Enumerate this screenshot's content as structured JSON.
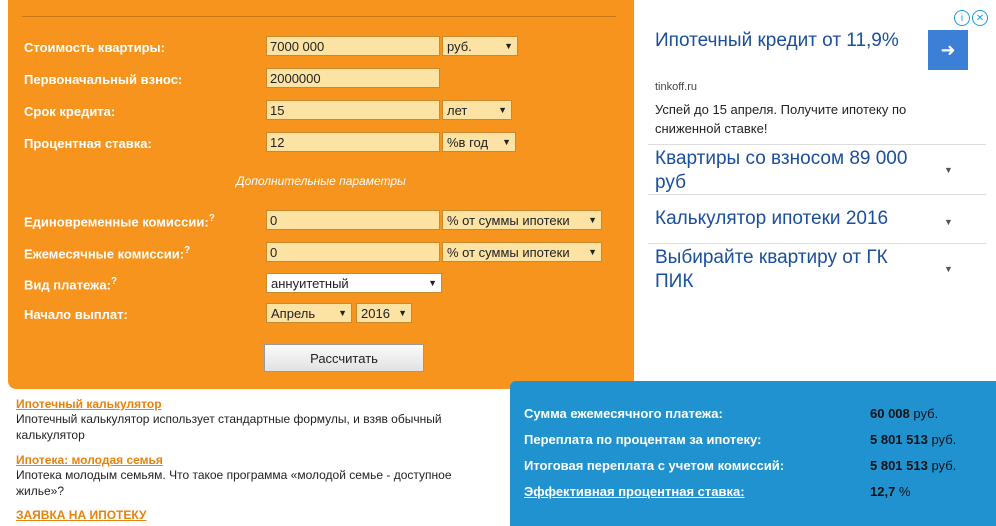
{
  "calculator": {
    "price_label": "Стоимость квартиры:",
    "price_value": "7000 000",
    "price_currency": "руб.",
    "downpayment_label": "Первоначальный взнос:",
    "downpayment_value": "2000000",
    "term_label": "Срок кредита:",
    "term_value": "15",
    "term_unit": "лет",
    "rate_label": "Процентная ставка:",
    "rate_value": "12",
    "rate_unit": "%в год",
    "extra_params": "Дополнительные параметры",
    "onetime_label": "Единовременные комиссии:",
    "onetime_value": "0",
    "onetime_unit": "% от суммы ипотеки",
    "monthly_label": "Ежемесячные комиссии:",
    "monthly_value": "0",
    "monthly_unit": "% от суммы ипотеки",
    "paytype_label": "Вид платежа:",
    "paytype_value": "аннуитетный",
    "start_label": "Начало выплат:",
    "start_month": "Апрель",
    "start_year": "2016",
    "help_mark": "?",
    "calculate_button": "Рассчитать"
  },
  "ad": {
    "headline": "Ипотечный кредит от 11,9%",
    "domain": "tinkoff.ru",
    "description": "Успей до 15 апреля. Получите ипотеку по сниженной ставке!",
    "items": [
      {
        "title": "Квартиры со взносом 89 000 руб"
      },
      {
        "title": "Калькулятор ипотеки 2016"
      },
      {
        "title": "Выбирайте квартиру от ГК ПИК"
      }
    ]
  },
  "links": {
    "link1_title": "Ипотечный калькулятор",
    "link1_text": "Ипотечный калькулятор использует стандартные формулы, и взяв обычный калькулятор",
    "link2_title": "Ипотека: молодая семья",
    "link2_text": "Ипотека молодым семьям. Что такое программа «молодой семье - доступное жилье»?",
    "link3_title": "ЗАЯВКА НА ИПОТЕКУ"
  },
  "results": {
    "monthly_label": "Сумма ежемесячного платежа:",
    "monthly_value": "60 008",
    "overpay_label": "Переплата по процентам за ипотеку:",
    "overpay_value": "5 801 513",
    "total_label": "Итоговая переплата с учетом комиссий:",
    "total_value": "5 801 513",
    "effective_label": "Эффективная процентная ставка:",
    "effective_value": "12,7",
    "currency": "руб.",
    "percent": "%"
  },
  "colors": {
    "orange": "#f7941d",
    "blue": "#2092d0",
    "input_bg": "#fce3a3",
    "ad_link": "#1a4e9e"
  }
}
